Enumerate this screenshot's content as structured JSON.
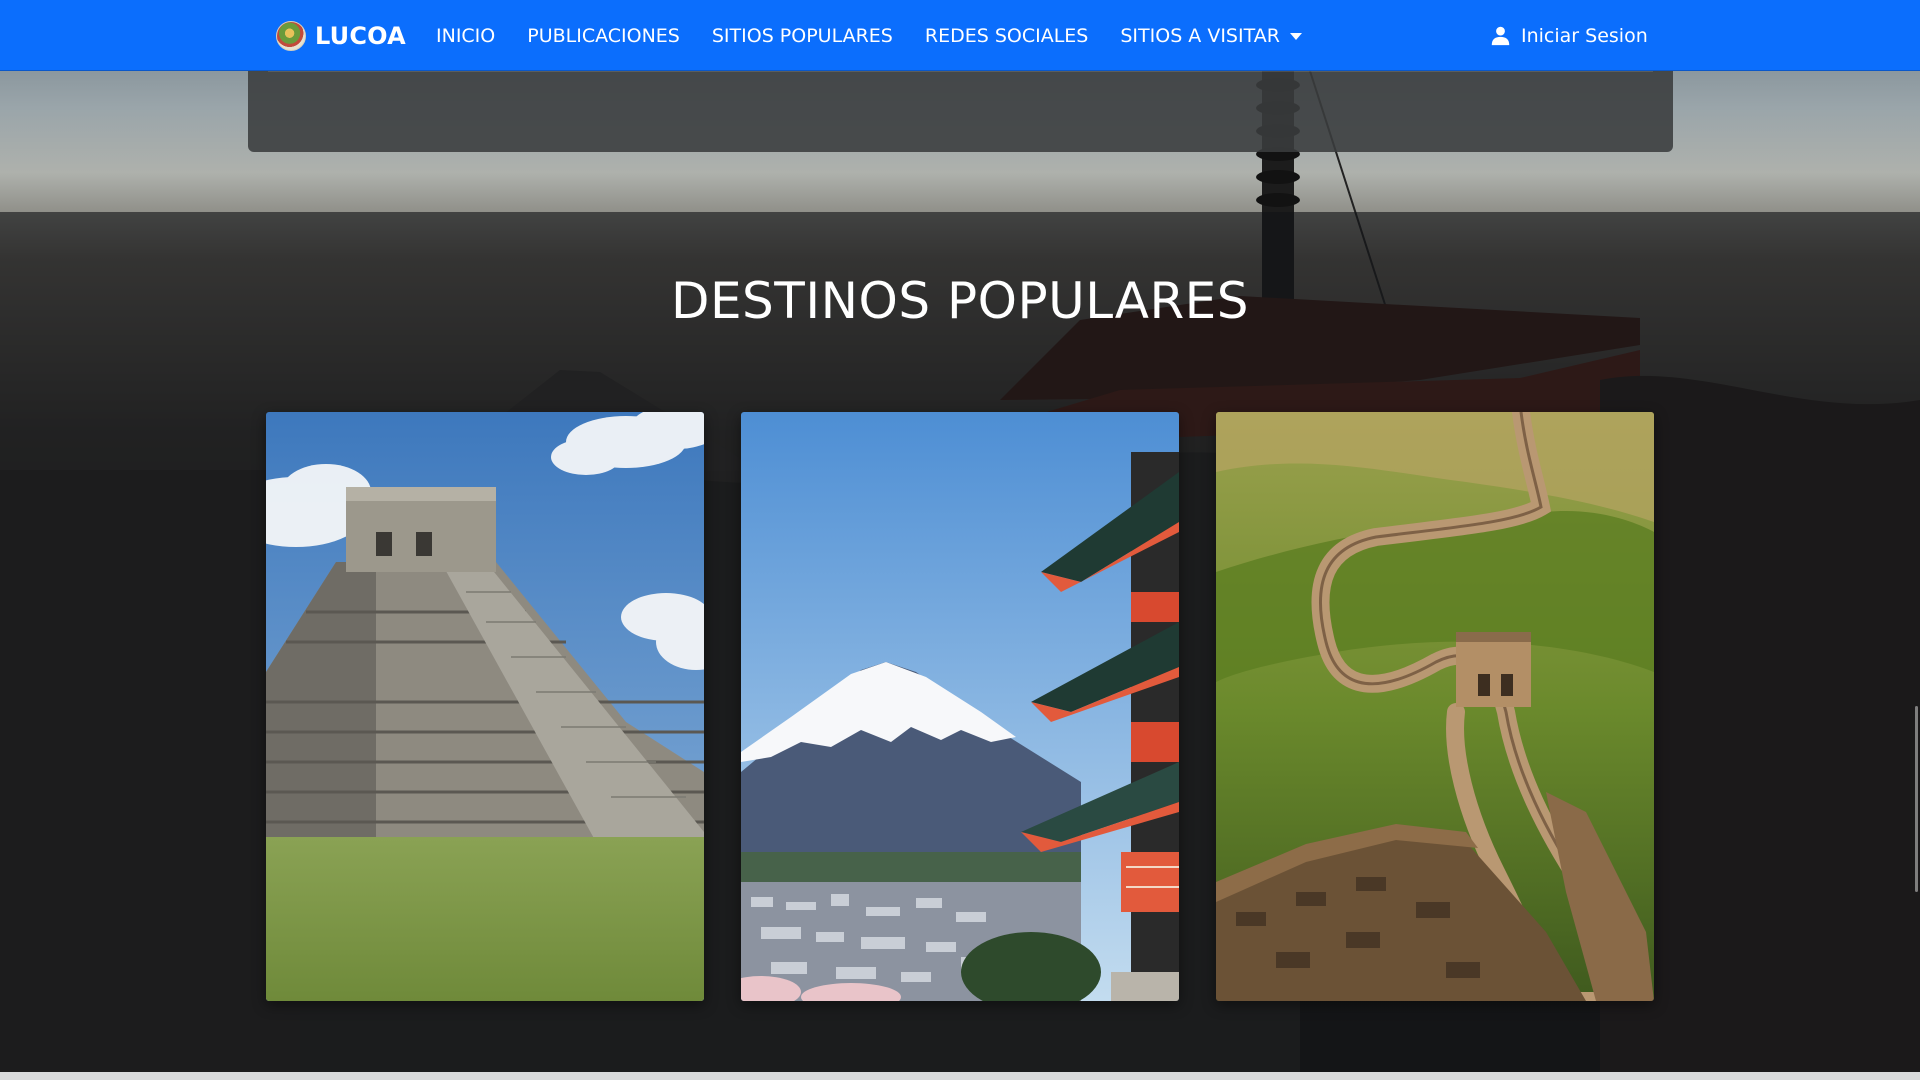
{
  "navbar": {
    "brand": "LUCOA",
    "links": [
      {
        "label": "INICIO"
      },
      {
        "label": "PUBLICACIONES"
      },
      {
        "label": "SITIOS POPULARES"
      },
      {
        "label": "REDES SOCIALES"
      },
      {
        "label": "SITIOS A VISITAR"
      }
    ],
    "login_label": "Iniciar Sesion"
  },
  "section": {
    "title": "DESTINOS POPULARES"
  },
  "cards": [
    {
      "image": "chichen-itza-pyramid"
    },
    {
      "image": "mount-fuji-pagoda"
    },
    {
      "image": "great-wall-of-china"
    }
  ],
  "colors": {
    "navbar": "#0b6efd",
    "text": "#ffffff",
    "overlay": "#121416"
  }
}
